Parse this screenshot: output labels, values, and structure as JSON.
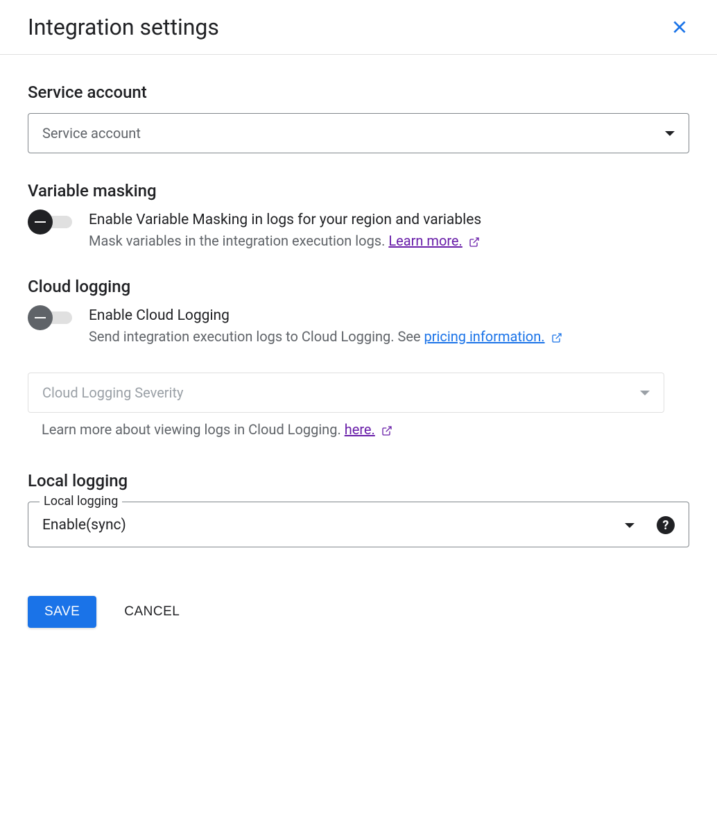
{
  "header": {
    "title": "Integration settings"
  },
  "service_account": {
    "heading": "Service account",
    "placeholder": "Service account"
  },
  "variable_masking": {
    "heading": "Variable masking",
    "toggle_label": "Enable Variable Masking in logs for your region and variables",
    "toggle_desc": "Mask variables in the integration execution logs. ",
    "learn_more": "Learn more."
  },
  "cloud_logging": {
    "heading": "Cloud logging",
    "toggle_label": "Enable Cloud Logging",
    "toggle_desc": "Send integration execution logs to Cloud Logging. See ",
    "pricing_link": "pricing information.",
    "severity_placeholder": "Cloud Logging Severity",
    "helper_text": "Learn more about viewing logs in Cloud Logging. ",
    "here_link": "here."
  },
  "local_logging": {
    "heading": "Local logging",
    "floating_label": "Local logging",
    "value": "Enable(sync)"
  },
  "buttons": {
    "save": "SAVE",
    "cancel": "CANCEL"
  }
}
